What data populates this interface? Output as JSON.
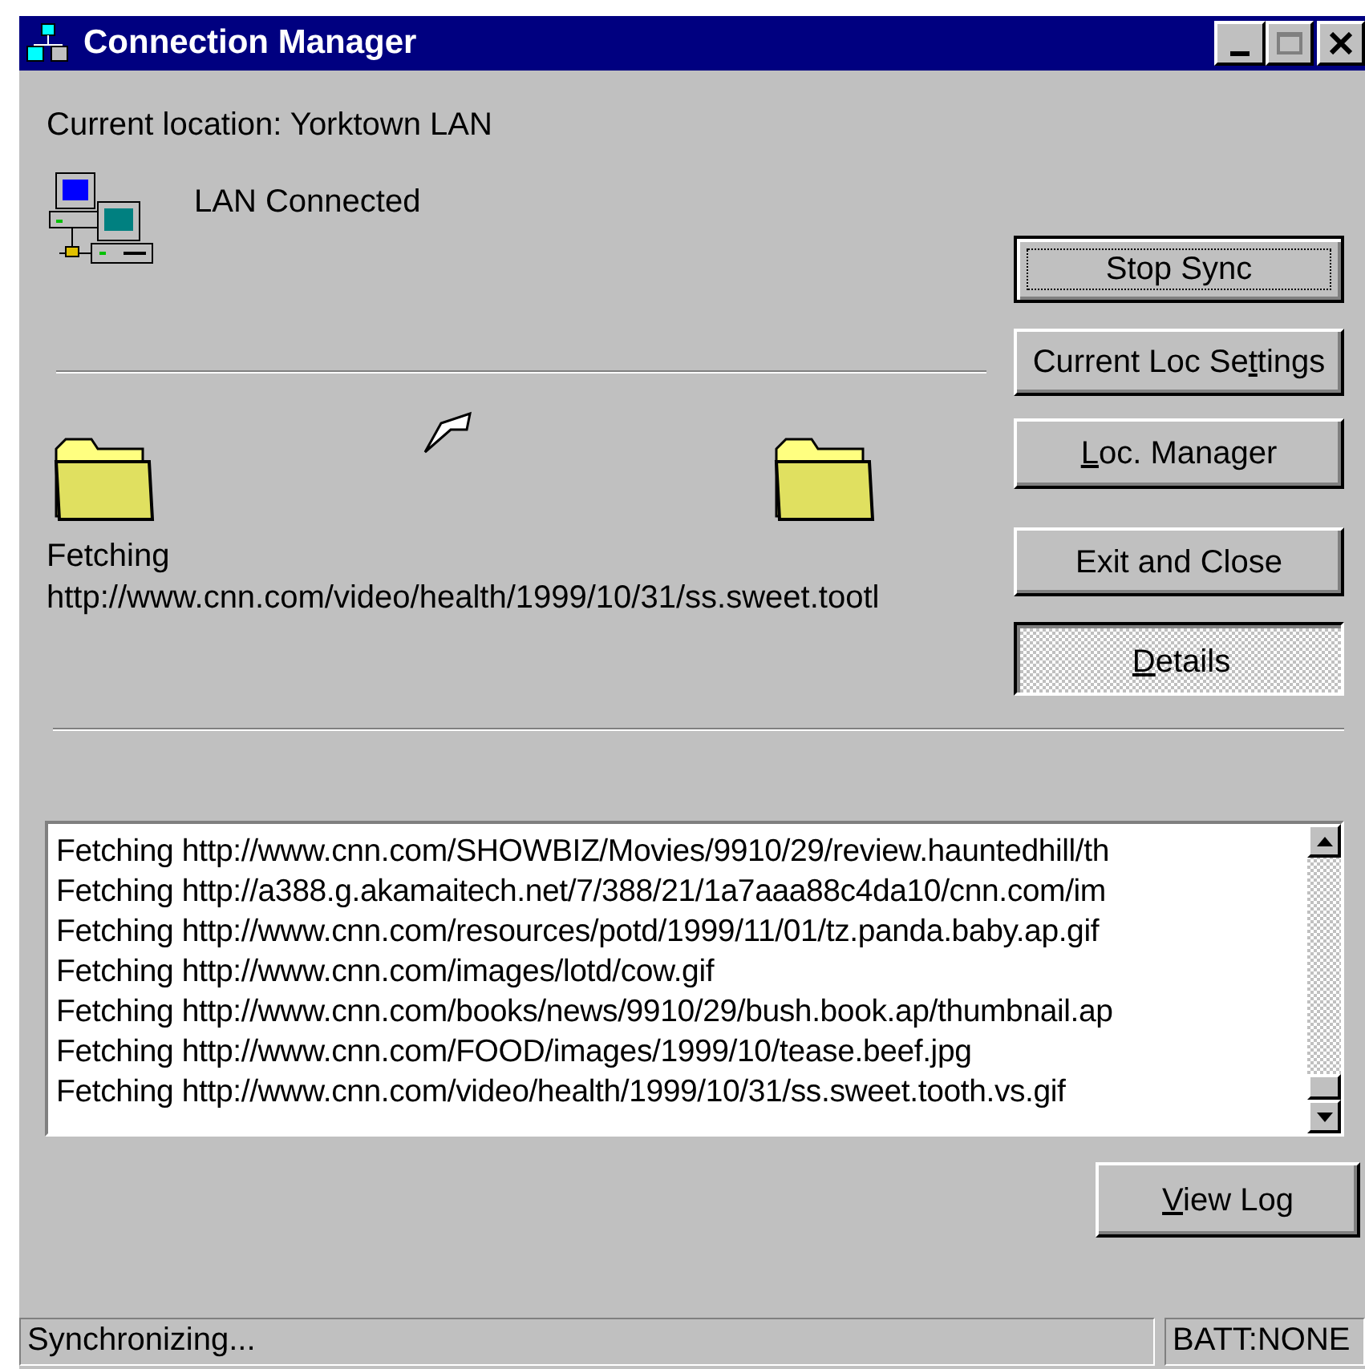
{
  "window": {
    "title": "Connection Manager"
  },
  "location": "Current location: Yorktown LAN",
  "connection_status": "LAN Connected",
  "buttons": [
    {
      "before": "Stop Sync",
      "focused": true,
      "pressed": false
    },
    {
      "before": "Current Loc Se",
      "key": "t",
      "after": "tings",
      "focused": false,
      "pressed": false
    },
    {
      "key": "L",
      "after": "oc. Manager",
      "focused": false,
      "pressed": false
    },
    {
      "before": "Exit and Close",
      "focused": false,
      "pressed": false
    },
    {
      "key": "D",
      "after": "etails",
      "focused": false,
      "pressed": true
    }
  ],
  "transfer": {
    "status": "Fetching",
    "url": "http://www.cnn.com/video/health/1999/10/31/ss.sweet.tootl"
  },
  "log": {
    "lines": [
      "Fetching http://www.cnn.com/SHOWBIZ/Movies/9910/29/review.hauntedhill/th",
      "Fetching http://a388.g.akamaitech.net/7/388/21/1a7aaa88c4da10/cnn.com/im",
      "Fetching http://www.cnn.com/resources/potd/1999/11/01/tz.panda.baby.ap.gif",
      "Fetching http://www.cnn.com/images/lotd/cow.gif",
      "Fetching http://www.cnn.com/books/news/9910/29/bush.book.ap/thumbnail.ap",
      "Fetching http://www.cnn.com/FOOD/images/1999/10/tease.beef.jpg",
      "Fetching http://www.cnn.com/video/health/1999/10/31/ss.sweet.tooth.vs.gif"
    ]
  },
  "view_log_button": {
    "key": "V",
    "after": "iew Log",
    "focused": false,
    "pressed": false
  },
  "status_bar": {
    "message": "Synchronizing...",
    "battery": "BATT:NONE"
  }
}
